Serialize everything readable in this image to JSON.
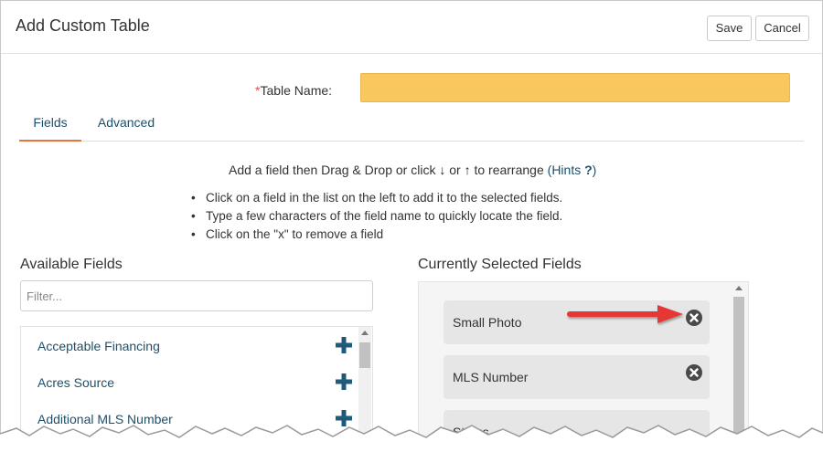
{
  "dialog": {
    "title": "Add Custom Table",
    "save_label": "Save",
    "cancel_label": "Cancel"
  },
  "table_name": {
    "required_mark": "*",
    "label": "Table Name:",
    "value": "",
    "highlight_color": "#f8c85f"
  },
  "tabs": [
    {
      "label": "Fields",
      "active": true
    },
    {
      "label": "Advanced",
      "active": false
    }
  ],
  "hint": {
    "prefix": "Add a field then Drag & Drop or click",
    "down_arrow": "↓",
    "or": "or",
    "up_arrow": "↑",
    "suffix": "to rearrange",
    "link_open": "(",
    "link_label": "Hints",
    "link_icon": "?",
    "link_close": ")"
  },
  "instructions": [
    "Click on a field in the list on the left to add it to the selected fields.",
    "Type a few characters of the field name to quickly locate the field.",
    "Click on the \"x\" to remove a field"
  ],
  "available": {
    "title": "Available Fields",
    "filter_placeholder": "Filter...",
    "items": [
      {
        "label": "Acceptable Financing",
        "icon": "plus-icon"
      },
      {
        "label": "Acres Source",
        "icon": "plus-icon"
      },
      {
        "label": "Additional MLS Number",
        "icon": "plus-icon"
      }
    ]
  },
  "selected": {
    "title": "Currently Selected Fields",
    "items": [
      {
        "label": "Small Photo",
        "icon": "remove-circle-icon"
      },
      {
        "label": "MLS Number",
        "icon": "remove-circle-icon"
      },
      {
        "label": "Status",
        "icon": "remove-circle-icon"
      }
    ]
  },
  "colors": {
    "accent_tab": "#e8743b",
    "link": "#1e4f6a",
    "annotation_arrow": "#e53935"
  }
}
